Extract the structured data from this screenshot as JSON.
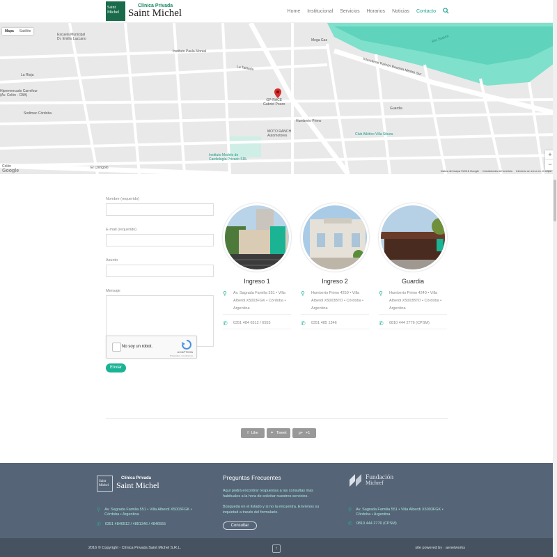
{
  "header": {
    "logo_box_line1": "Saint",
    "logo_box_line2": "Michel",
    "logo_small": "Clínica Privada",
    "logo_big": "Saint Michel",
    "nav": [
      "Home",
      "Institucional",
      "Servicios",
      "Horarios",
      "Noticias",
      "Contacto"
    ],
    "active_nav": "Contacto",
    "search_icon": "search-icon"
  },
  "map": {
    "type_buttons": [
      "Mapa",
      "Satélite"
    ],
    "labels": {
      "escuela": "Escuela Municipal\nDr. Emilio Lazcano",
      "instituto": "Instituto Paula Montal",
      "carrefour": "Hipermercado Carrefour\n(Av. Colón - CBA)",
      "sodimac": "Sodimac Córdoba",
      "gprace": "GP-RACE\nGabriel Pozzo",
      "moto": "MOTO RANCH\nAutomotores",
      "club": "Club Atlético Villa Siburu",
      "megagas": "Mega Gas",
      "cardio": "Instituto Modelo de\nCardiología Privado SRL",
      "chingolo": "El Chingolo",
      "rio": "Río Suquía",
      "colon": "Colón",
      "larioja": "La Rioja",
      "tablada": "La Tablada",
      "humberto": "Humberto Primo",
      "guardia": "Guardia",
      "intendente": "Intendente Ramón Bautista Mestre Sur"
    },
    "zoom_in": "+",
    "zoom_out": "−",
    "footer": [
      "Datos del mapa ©2016 Google",
      "Condiciones del servicio",
      "Informar un error en el mapa"
    ],
    "google": "Google"
  },
  "form": {
    "name_label": "Nombre (requerido)",
    "email_label": "E-mail (requerido)",
    "subject_label": "Asunto",
    "message_label": "Mensaje",
    "captcha_text": "No soy un robot.",
    "captcha_brand": "reCAPTCHA",
    "captcha_sub": "Privacidad - Condiciones",
    "send": "Enviar"
  },
  "locations": [
    {
      "name": "Ingreso 1",
      "address": "Av. Sagrada Familia 551 • Villa Alberdi X5003FGK • Córdoba • Argentina",
      "phone": "0351 484 6512 / 6555"
    },
    {
      "name": "Ingreso 2",
      "address": "Humberto Primo 4250 • Villa Alberdi X5003BTD • Córdoba • Argentina",
      "phone": "0351 485 1346"
    },
    {
      "name": "Guardia",
      "address": "Humberto Primo 4240 • Villa Alberdi X5003BTD • Córdoba • Argentina",
      "phone": "0810 444 2776 (CPSM)"
    }
  ],
  "share": {
    "like": "Like",
    "tweet": "Tweet",
    "plus": "+1"
  },
  "footer": {
    "logo_box_line1": "Saint",
    "logo_box_line2": "Michel",
    "logo_small": "Clínica Privada",
    "logo_big": "Saint Michel",
    "address": "Av. Sagrada Familia 551 • Villa Alberdi X5003FGK • Córdoba • Argentina",
    "phones": "0351 4846512 / 4851346 / 4846555",
    "faq_title": "Preguntas Frecuentes",
    "faq_text1": "Aquí podrá encontrar respuestas a las consultas mas habituales a la hora de solicitar nuestros servicios.",
    "faq_text2": "Búsqueda en el listado y si no la encuentra. Envíenos su inquietud a través del formulario.",
    "faq_button": "Consultar",
    "fund_name1": "Fundación",
    "fund_name2": "Michref",
    "fund_address": "Av. Sagrada Familia 551 • Villa Alberdi X5003FGK • Córdoba • Argentina",
    "fund_phone": "0810 444 2776 (CPSM)"
  },
  "bottom": {
    "copyright": "2016 © Copyright - Clínica Privada Saint Michel S.R.L.",
    "powered": "site powered by",
    "powered_brand": "aenetworks",
    "top_button": "↑"
  },
  "colors": {
    "accent": "#1ab394",
    "footer": "#566477",
    "bottom": "#46525f",
    "river": "#7fe0cc"
  }
}
